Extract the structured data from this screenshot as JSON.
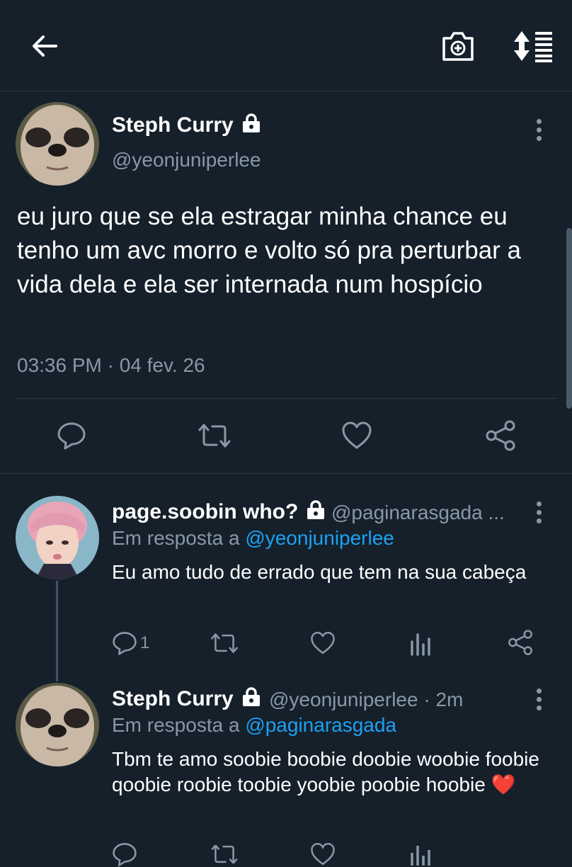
{
  "main_tweet": {
    "name": "Steph Curry",
    "handle": "@yeonjuniperlee",
    "text": "eu juro que se ela estragar minha chance eu tenho um avc morro e volto só pra perturbar a vida dela e ela ser internada num hospício",
    "timestamp": "03:36 PM · 04 fev. 26"
  },
  "replies": [
    {
      "name": "page.soobin who?",
      "handle": "@paginarasgada ...",
      "reply_prefix": "Em resposta a ",
      "reply_to": "@yeonjuniperlee",
      "text": "Eu amo tudo de errado que tem na sua cabeça",
      "reply_count": "1"
    },
    {
      "name": "Steph Curry",
      "handle": "@yeonjuniperlee · 2m",
      "reply_prefix": "Em resposta a ",
      "reply_to": "@paginarasgada",
      "text": "Tbm te amo soobie boobie doobie woobie foobie qoobie roobie toobie yoobie poobie hoobie",
      "emoji": "❤️"
    }
  ],
  "icons": {
    "back": "arrow-left-icon",
    "camera": "camera-add-icon",
    "sort": "sort-list-icon",
    "reply": "reply-icon",
    "retweet": "retweet-icon",
    "like": "heart-icon",
    "share": "share-icon",
    "analytics": "analytics-icon",
    "more": "more-vertical-icon",
    "lock": "lock-icon"
  },
  "colors": {
    "background": "#15202b",
    "text_secondary": "#8899a6",
    "accent": "#1da1f2",
    "heart_emoji": "#e0245e"
  }
}
